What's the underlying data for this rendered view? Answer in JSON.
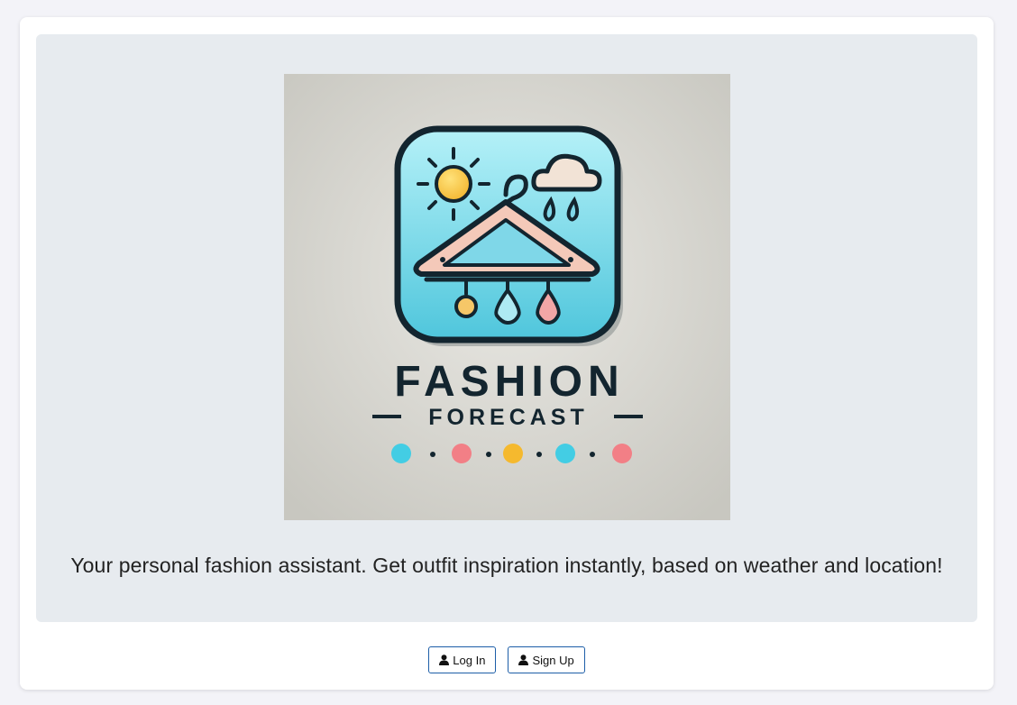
{
  "logo": {
    "title_line1": "FASHION",
    "title_line2": "FORECAST",
    "colors": {
      "background": "#d6d5cf",
      "tile": "#7fd7e8",
      "outline": "#13252f",
      "sun": "#f6c23e",
      "hanger": "#f4c9b9",
      "dots": [
        "#43cde4",
        "#f27f86",
        "#f5b92e",
        "#43cde4",
        "#f27f86"
      ]
    }
  },
  "hero": {
    "tagline": "Your personal fashion assistant. Get outfit inspiration instantly, based on weather and location!"
  },
  "actions": {
    "login_label": "Log In",
    "signup_label": "Sign Up",
    "icon": "user-icon"
  }
}
